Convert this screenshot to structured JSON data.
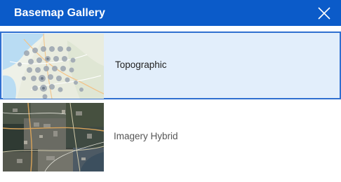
{
  "window": {
    "title": "Basemap Gallery"
  },
  "icons": {
    "close": "close-icon"
  },
  "basemaps": [
    {
      "label": "Topographic",
      "selected": true,
      "thumbnail": "topographic-map-thumbnail"
    },
    {
      "label": "Imagery Hybrid",
      "selected": false,
      "thumbnail": "imagery-hybrid-thumbnail"
    }
  ],
  "colors": {
    "header": "#0b5bc9",
    "selected_background": "#e2eefb",
    "selected_border": "#2f6fd0"
  }
}
